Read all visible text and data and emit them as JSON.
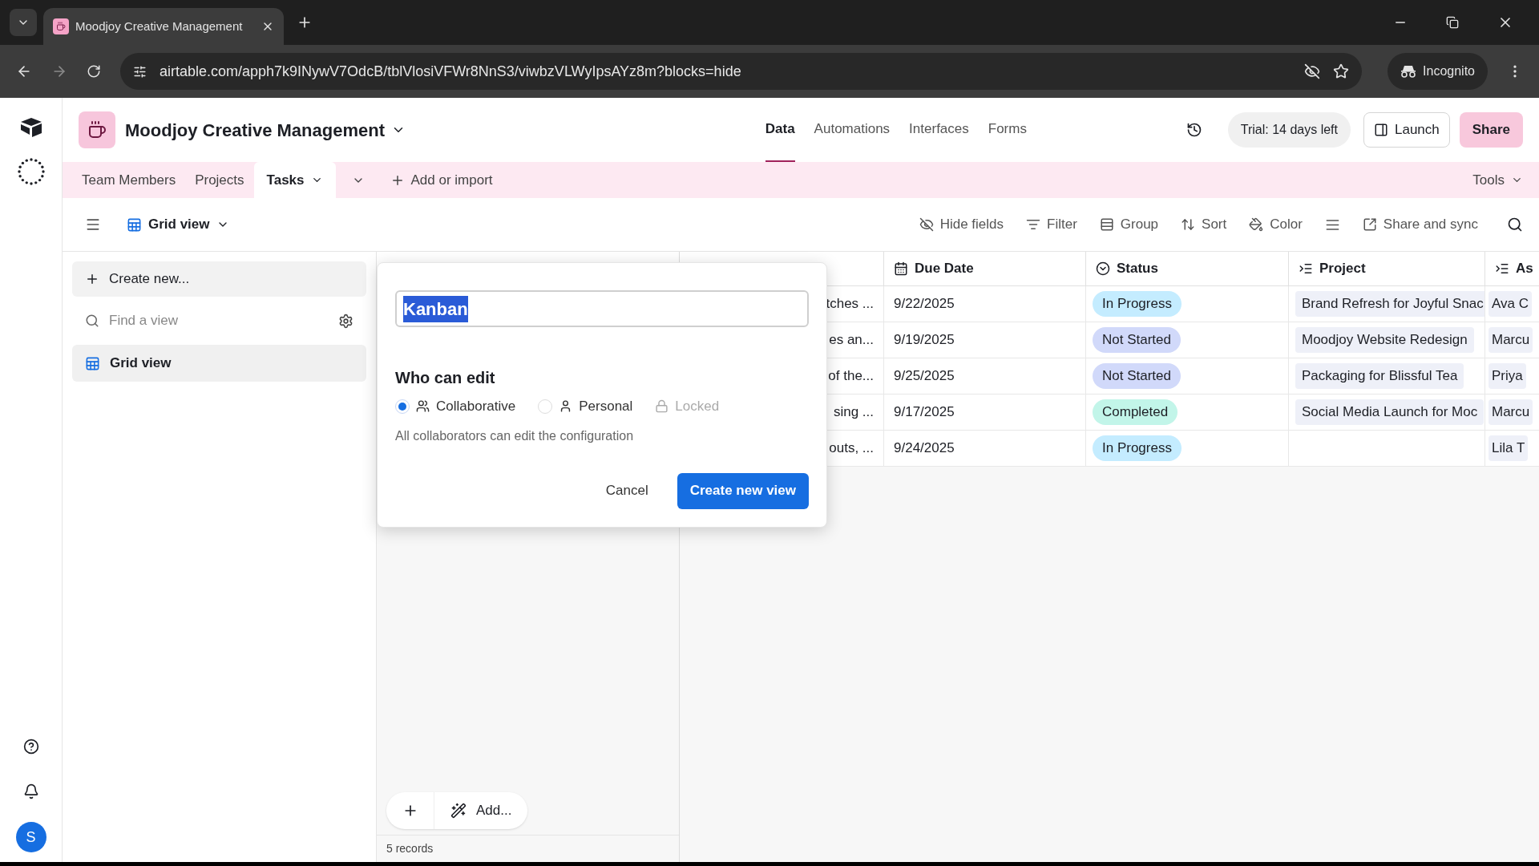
{
  "browser": {
    "tab_title": "Moodjoy Creative Management",
    "url": "airtable.com/apph7k9INywV7OdcB/tblVlosiVFWr8NnS3/viwbzVLWyIpsAYz8m?blocks=hide",
    "profile": "Incognito"
  },
  "app": {
    "base_name": "Moodjoy Creative Management",
    "nav": [
      {
        "label": "Data",
        "selected": true
      },
      {
        "label": "Automations",
        "selected": false
      },
      {
        "label": "Interfaces",
        "selected": false
      },
      {
        "label": "Forms",
        "selected": false
      }
    ],
    "trial": "Trial: 14 days left",
    "launch": "Launch",
    "share": "Share"
  },
  "tables": [
    {
      "label": "Team Members",
      "selected": false
    },
    {
      "label": "Projects",
      "selected": false
    },
    {
      "label": "Tasks",
      "selected": true
    }
  ],
  "add_table": "Add or import",
  "tools": "Tools",
  "toolbar": {
    "view_name": "Grid view",
    "actions": [
      {
        "kind": "hide",
        "label": "Hide fields"
      },
      {
        "kind": "filter",
        "label": "Filter"
      },
      {
        "kind": "group",
        "label": "Group"
      },
      {
        "kind": "sort",
        "label": "Sort"
      },
      {
        "kind": "color",
        "label": "Color"
      },
      {
        "kind": "rowheight"
      },
      {
        "kind": "share",
        "label": "Share and sync"
      }
    ]
  },
  "sidebar": {
    "create": "Create new...",
    "search_placeholder": "Find a view",
    "views": [
      {
        "label": "Grid view",
        "selected": true
      }
    ]
  },
  "table": {
    "columns": [
      {
        "kind": "date",
        "label": "Due Date"
      },
      {
        "kind": "status",
        "label": "Status"
      },
      {
        "kind": "link",
        "label": "Project"
      },
      {
        "kind": "link",
        "label": "As"
      }
    ],
    "rows": [
      {
        "column_2": "tches ...",
        "due": "9/22/2025",
        "status": "In Progress",
        "color": "#c4ecff",
        "project": "Brand Refresh for Joyful Snac",
        "assignee": "Ava C"
      },
      {
        "column_2": "es an...",
        "due": "9/19/2025",
        "status": "Not Started",
        "color": "#d1d9fa",
        "project": "Moodjoy Website Redesign",
        "assignee": "Marcu"
      },
      {
        "column_2": "of the...",
        "due": "9/25/2025",
        "status": "Not Started",
        "color": "#d1d9fa",
        "project": "Packaging for Blissful Tea",
        "assignee": "Priya"
      },
      {
        "column_2": "sing ...",
        "due": "9/17/2025",
        "status": "Completed",
        "color": "#c2f5e9",
        "project": "Social Media Launch for Moc",
        "assignee": "Marcu"
      },
      {
        "column_2": "outs, ...",
        "due": "9/24/2025",
        "status": "In Progress",
        "color": "#c4ecff",
        "project": "",
        "assignee": "Lila T"
      }
    ],
    "add": "Add...",
    "records": "5 records"
  },
  "dialog": {
    "name_value": "Kanban",
    "name_selected": true,
    "heading": "Who can edit",
    "options": [
      {
        "kind": "collaborative",
        "label": "Collaborative",
        "selected": true,
        "disabled": false
      },
      {
        "kind": "personal",
        "label": "Personal",
        "selected": false,
        "disabled": false
      },
      {
        "kind": "locked",
        "label": "Locked",
        "disabled": true
      }
    ],
    "description": "All collaborators can edit the configuration",
    "cancel": "Cancel",
    "confirm": "Create new view"
  },
  "avatar": "S"
}
